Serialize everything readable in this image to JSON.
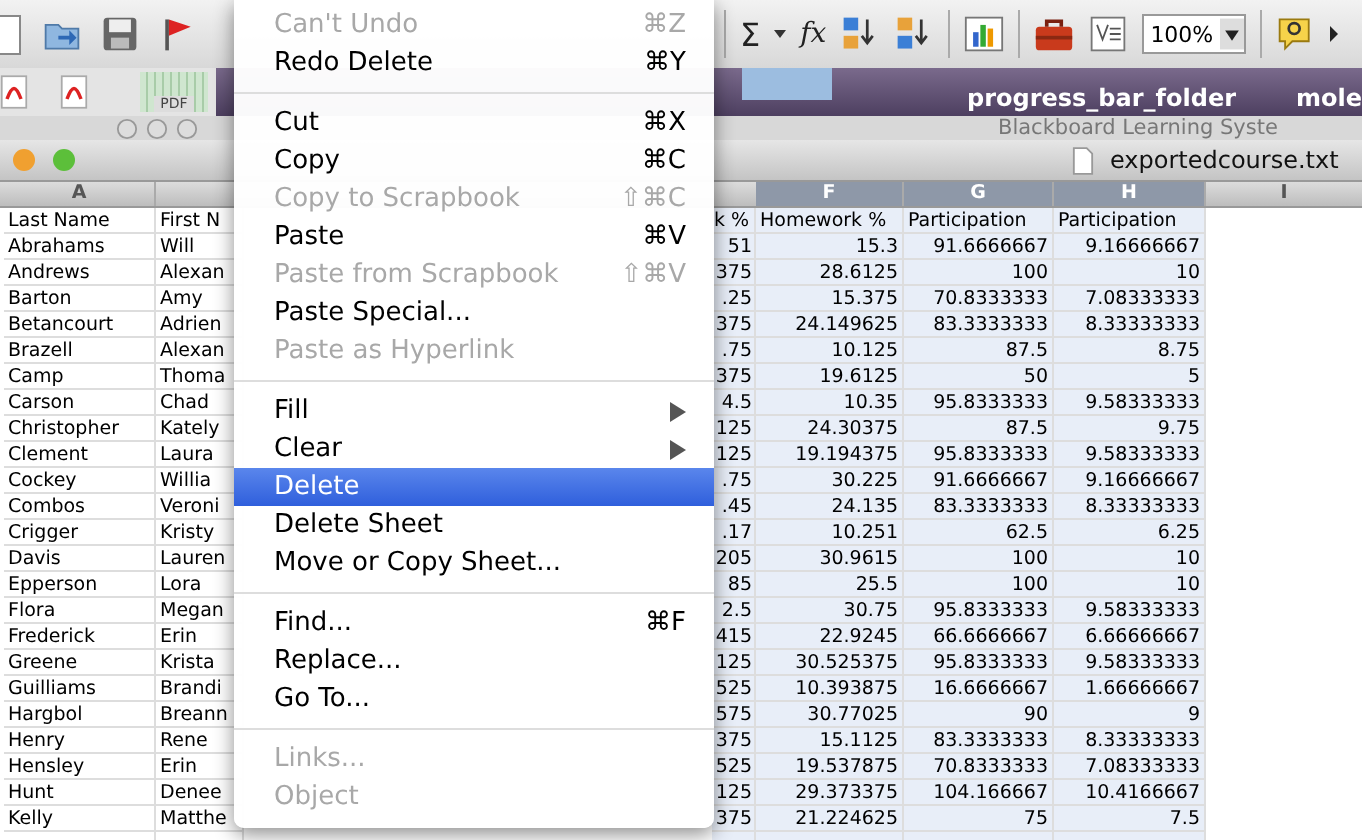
{
  "toolbar": {
    "sum_label": "Σ",
    "function_label": "fx",
    "zoom": "100%"
  },
  "dock_row": {
    "thumbnail_label": "PDF",
    "folders": [
      "progress_bar_folder",
      "mole"
    ]
  },
  "background_window": {
    "title": "Blackboard Learning Syste"
  },
  "window": {
    "title": "exportedcourse.txt"
  },
  "sheet": {
    "column_headers": [
      "A",
      "F",
      "G",
      "H",
      "I"
    ],
    "rows": [
      [
        "Last Name",
        "First N",
        "k %",
        "Homework %",
        "Participation",
        "Participation"
      ],
      [
        "Abrahams",
        "Will",
        "51",
        "15.3",
        "91.6666667",
        "9.16666667"
      ],
      [
        "Andrews",
        "Alexan",
        "375",
        "28.6125",
        "100",
        "10"
      ],
      [
        "Barton",
        "Amy",
        ".25",
        "15.375",
        "70.8333333",
        "7.08333333"
      ],
      [
        "Betancourt",
        "Adrien",
        "375",
        "24.149625",
        "83.3333333",
        "8.33333333"
      ],
      [
        "Brazell",
        "Alexan",
        ".75",
        "10.125",
        "87.5",
        "8.75"
      ],
      [
        "Camp",
        "Thoma",
        "375",
        "19.6125",
        "50",
        "5"
      ],
      [
        "Carson",
        "Chad",
        "4.5",
        "10.35",
        "95.8333333",
        "9.58333333"
      ],
      [
        "Christopher",
        "Kately",
        "125",
        "24.30375",
        "87.5",
        "9.75"
      ],
      [
        "Clement",
        "Laura",
        "125",
        "19.194375",
        "95.8333333",
        "9.58333333"
      ],
      [
        "Cockey",
        "Willia",
        ".75",
        "30.225",
        "91.6666667",
        "9.16666667"
      ],
      [
        "Combos",
        "Veroni",
        ".45",
        "24.135",
        "83.3333333",
        "8.33333333"
      ],
      [
        "Crigger",
        "Kristy",
        ".17",
        "10.251",
        "62.5",
        "6.25"
      ],
      [
        "Davis",
        "Lauren",
        "205",
        "30.9615",
        "100",
        "10"
      ],
      [
        "Epperson",
        "Lora",
        "85",
        "25.5",
        "100",
        "10"
      ],
      [
        "Flora",
        "Megan",
        "2.5",
        "30.75",
        "95.8333333",
        "9.58333333"
      ],
      [
        "Frederick",
        "Erin",
        "415",
        "22.9245",
        "66.6666667",
        "6.66666667"
      ],
      [
        "Greene",
        "Krista",
        "125",
        "30.525375",
        "95.8333333",
        "9.58333333"
      ],
      [
        "Guilliams",
        "Brandi",
        "525",
        "10.393875",
        "16.6666667",
        "1.66666667"
      ],
      [
        "Hargbol",
        "Breann",
        "575",
        "30.77025",
        "90",
        "9"
      ],
      [
        "Henry",
        "Rene",
        "375",
        "15.1125",
        "83.3333333",
        "8.33333333"
      ],
      [
        "Hensley",
        "Erin",
        "525",
        "19.537875",
        "70.8333333",
        "7.08333333"
      ],
      [
        "Hunt",
        "Denee",
        "125",
        "29.373375",
        "104.166667",
        "10.4166667"
      ],
      [
        "Kelly",
        "Matthe",
        "375",
        "21.224625",
        "75",
        "7.5"
      ]
    ]
  },
  "menu": {
    "groups": [
      [
        {
          "label": "Can't Undo",
          "shortcut": "⌘Z",
          "disabled": true,
          "selected": false,
          "submenu": false
        },
        {
          "label": "Redo Delete",
          "shortcut": "⌘Y",
          "disabled": false,
          "selected": false,
          "submenu": false
        }
      ],
      [
        {
          "label": "Cut",
          "shortcut": "⌘X",
          "disabled": false,
          "selected": false,
          "submenu": false
        },
        {
          "label": "Copy",
          "shortcut": "⌘C",
          "disabled": false,
          "selected": false,
          "submenu": false
        },
        {
          "label": "Copy to Scrapbook",
          "shortcut": "⇧⌘C",
          "disabled": true,
          "selected": false,
          "submenu": false
        },
        {
          "label": "Paste",
          "shortcut": "⌘V",
          "disabled": false,
          "selected": false,
          "submenu": false
        },
        {
          "label": "Paste from Scrapbook",
          "shortcut": "⇧⌘V",
          "disabled": true,
          "selected": false,
          "submenu": false
        },
        {
          "label": "Paste Special...",
          "disabled": false,
          "selected": false,
          "submenu": false
        },
        {
          "label": "Paste as Hyperlink",
          "disabled": true,
          "selected": false,
          "submenu": false
        }
      ],
      [
        {
          "label": "Fill",
          "disabled": false,
          "selected": false,
          "submenu": true
        },
        {
          "label": "Clear",
          "disabled": false,
          "selected": false,
          "submenu": true
        },
        {
          "label": "Delete",
          "disabled": false,
          "selected": true,
          "submenu": false
        },
        {
          "label": "Delete Sheet",
          "disabled": false,
          "selected": false,
          "submenu": false
        },
        {
          "label": "Move or Copy Sheet...",
          "disabled": false,
          "selected": false,
          "submenu": false
        }
      ],
      [
        {
          "label": "Find...",
          "shortcut": "⌘F",
          "disabled": false,
          "selected": false,
          "submenu": false
        },
        {
          "label": "Replace...",
          "disabled": false,
          "selected": false,
          "submenu": false
        },
        {
          "label": "Go To...",
          "disabled": false,
          "selected": false,
          "submenu": false
        }
      ],
      [
        {
          "label": "Links...",
          "disabled": true,
          "selected": false,
          "submenu": false
        },
        {
          "label": "Object",
          "disabled": true,
          "selected": false,
          "submenu": false
        }
      ]
    ]
  }
}
